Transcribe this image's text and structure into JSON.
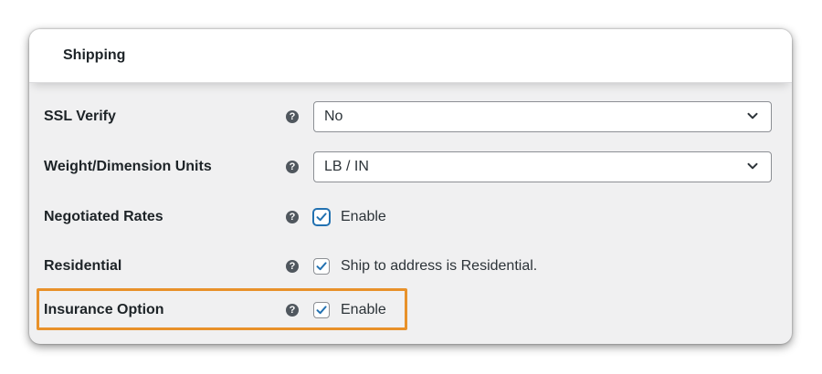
{
  "section": {
    "title": "Shipping"
  },
  "colors": {
    "accent": "#2271b1",
    "highlight": "#e8912a",
    "help_icon": "#50575e"
  },
  "rows": [
    {
      "label": "SSL Verify",
      "type": "select",
      "value": "No",
      "icon": "help-icon"
    },
    {
      "label": "Weight/Dimension Units",
      "type": "select",
      "value": "LB / IN",
      "icon": "help-icon"
    },
    {
      "label": "Negotiated Rates",
      "type": "checkbox",
      "checked": true,
      "text": "Enable",
      "icon": "help-icon"
    },
    {
      "label": "Residential",
      "type": "checkbox",
      "checked": true,
      "text": "Ship to address is Residential.",
      "icon": "help-icon"
    },
    {
      "label": "Insurance Option",
      "type": "checkbox",
      "checked": true,
      "text": "Enable",
      "icon": "help-icon"
    }
  ],
  "help_glyph": "?"
}
